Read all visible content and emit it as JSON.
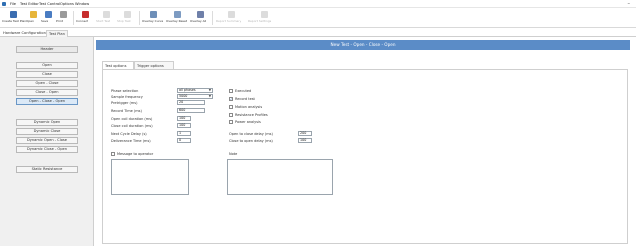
{
  "menubar": {
    "items": [
      "File",
      "Test Editor",
      "Test Control",
      "Options",
      "Window"
    ]
  },
  "toolbar": {
    "buttons": [
      {
        "label": "Create Test Plan",
        "color": "#3b6db0",
        "enabled": true
      },
      {
        "label": "Open",
        "color": "#e7b53a",
        "enabled": true
      },
      {
        "label": "Save",
        "color": "#4a7cc2",
        "enabled": true
      },
      {
        "label": "Print",
        "color": "#9a9a9a",
        "enabled": true
      },
      {
        "label": "Connect",
        "color": "#c62d2d",
        "enabled": true
      },
      {
        "label": "Start Test",
        "color": "#cfcfcf",
        "enabled": false
      },
      {
        "label": "Stop Test",
        "color": "#cfcfcf",
        "enabled": false
      },
      {
        "label": "Overlay Curve",
        "color": "#6e8fb8",
        "enabled": true
      },
      {
        "label": "Overlay Reset",
        "color": "#7d9bc2",
        "enabled": true
      },
      {
        "label": "Overlay All",
        "color": "#6f80a9",
        "enabled": true
      },
      {
        "label": "Report Summary",
        "color": "#d9d9d9",
        "enabled": false
      },
      {
        "label": "Report Settings",
        "color": "#d9d9d9",
        "enabled": false
      }
    ]
  },
  "tabs": {
    "hardware": "Hardware Configuration",
    "testplan": "Test Plan"
  },
  "sidebar": {
    "header": "Header",
    "items": [
      "Open",
      "Close",
      "Open - Close",
      "Close - Open",
      "Open - Close - Open",
      "Dynamic Open",
      "Dynamic Close",
      "Dynamic Open - Close",
      "Dynamic Close - Open",
      "Static Resistance"
    ],
    "selected_index": 4
  },
  "main": {
    "title": "New Test - Open - Close - Open",
    "inner_tabs": [
      "Test options",
      "Trigger options"
    ],
    "form": {
      "phase_selection_label": "Phase selection",
      "phase_selection_value": "all phases",
      "sample_frequency_label": "Sample frequency",
      "sample_frequency_value": "5000",
      "pretrigger_label": "Pretrigger (ms)",
      "pretrigger_value": "20",
      "record_time_label": "Record Time (ms)",
      "record_time_value": "600",
      "open_coil_label": "Open coil duration (ms)",
      "open_coil_value": "100",
      "close_coil_label": "Close coil duration (ms)",
      "close_coil_value": "100",
      "next_cycle_label": "Next Cycle Delay (s)",
      "next_cycle_value": "1",
      "deliverance_label": "Deliverance Time (ms)",
      "deliverance_value": "0",
      "open_to_close_label": "Open to close delay (ms)",
      "open_to_close_value": "200",
      "close_to_open_label": "Close to open delay (ms)",
      "close_to_open_value": "100",
      "message_label": "Message to operator",
      "notes_label": "Note"
    },
    "checkboxes": [
      {
        "label": "Executed",
        "checked": false
      },
      {
        "label": "Record test",
        "checked": true
      },
      {
        "label": "Motion analysis",
        "checked": false
      },
      {
        "label": "Resistance Profiles",
        "checked": false
      },
      {
        "label": "Power analysis",
        "checked": false
      }
    ]
  }
}
